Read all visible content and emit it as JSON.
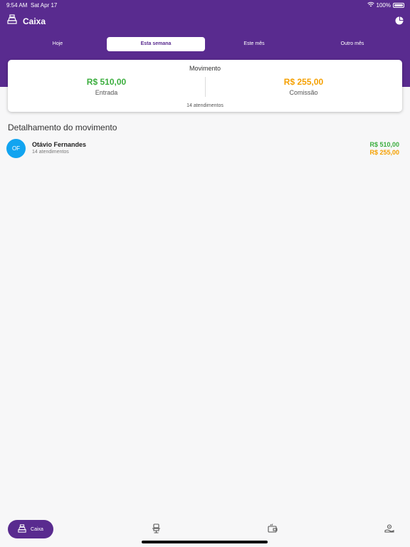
{
  "status_bar": {
    "time": "9:54 AM",
    "date": "Sat Apr 17",
    "battery": "100%"
  },
  "header": {
    "title": "Caixa"
  },
  "tabs": [
    {
      "label": "Hoje"
    },
    {
      "label": "Esta semana"
    },
    {
      "label": "Este mês"
    },
    {
      "label": "Outro mês"
    }
  ],
  "summary": {
    "title": "Movimento",
    "entrada_value": "R$ 510,00",
    "entrada_label": "Entrada",
    "comissao_value": "R$ 255,00",
    "comissao_label": "Comissão",
    "footer": "14 atendimentos"
  },
  "detail": {
    "title": "Detalhamento do movimento",
    "rows": [
      {
        "initials": "OF",
        "name": "Otávio Fernandes",
        "sub": "14 atendimentos",
        "entrada": "R$ 510,00",
        "comissao": "R$ 255,00"
      }
    ]
  },
  "bottom_nav": {
    "active_label": "Caixa",
    "icons": [
      "cash-register-icon",
      "barber-chair-icon",
      "wallet-icon",
      "settings-hand-icon"
    ]
  },
  "colors": {
    "primary": "#592b8f",
    "green": "#3cae3f",
    "orange": "#f5a000",
    "avatar": "#12a4f0"
  }
}
